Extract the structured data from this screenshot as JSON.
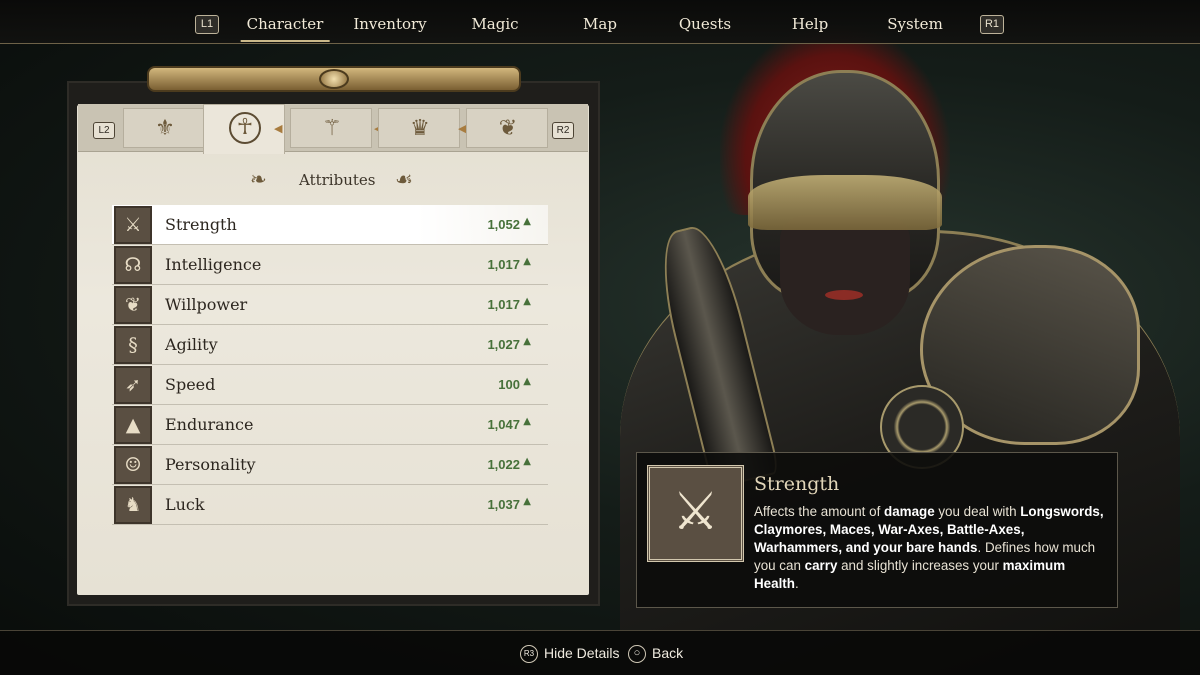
{
  "nav": {
    "left_button": "L1",
    "right_button": "R1",
    "tabs": [
      {
        "label": "Character"
      },
      {
        "label": "Inventory"
      },
      {
        "label": "Magic"
      },
      {
        "label": "Map"
      },
      {
        "label": "Quests"
      },
      {
        "label": "Help"
      },
      {
        "label": "System"
      }
    ],
    "active_tab": "Character"
  },
  "panel": {
    "left_button": "L2",
    "right_button": "R2",
    "category_tabs": [
      {
        "icon": "class-emblem-icon"
      },
      {
        "icon": "attributes-emblem-icon"
      },
      {
        "icon": "skills-emblem-icon"
      },
      {
        "icon": "crown-emblem-icon"
      },
      {
        "icon": "faction-emblem-icon"
      }
    ],
    "section_title": "Attributes",
    "accent_color": "#47713a",
    "attributes": [
      {
        "name": "Strength",
        "value": "1,052",
        "icon": "sword-fist-icon"
      },
      {
        "name": "Intelligence",
        "value": "1,017",
        "icon": "brain-icon"
      },
      {
        "name": "Willpower",
        "value": "1,017",
        "icon": "flame-hand-icon"
      },
      {
        "name": "Agility",
        "value": "1,027",
        "icon": "swirl-icon"
      },
      {
        "name": "Speed",
        "value": "100",
        "icon": "arrow-icon"
      },
      {
        "name": "Endurance",
        "value": "1,047",
        "icon": "mountain-icon"
      },
      {
        "name": "Personality",
        "value": "1,022",
        "icon": "mask-icon"
      },
      {
        "name": "Luck",
        "value": "1,037",
        "icon": "unicorn-icon"
      }
    ]
  },
  "detail": {
    "title": "Strength",
    "icon": "sword-fist-icon",
    "description": [
      {
        "t": "Affects the amount of ",
        "b": false
      },
      {
        "t": "damage",
        "b": true
      },
      {
        "t": " you deal with ",
        "b": false
      },
      {
        "t": "Longswords, Claymores, Maces, War-Axes, Battle-Axes, Warhammers, and your bare hands",
        "b": true
      },
      {
        "t": ". Defines how much you can ",
        "b": false
      },
      {
        "t": "carry",
        "b": true
      },
      {
        "t": " and slightly increases your ",
        "b": false
      },
      {
        "t": "maximum Health",
        "b": true
      },
      {
        "t": ".",
        "b": false
      }
    ]
  },
  "footer": {
    "hide_details_button": "R3",
    "hide_details_label": "Hide Details",
    "back_button": "○",
    "back_label": "Back"
  }
}
